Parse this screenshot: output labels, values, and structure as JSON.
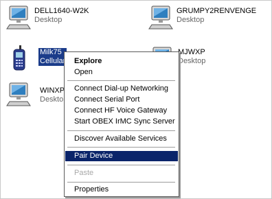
{
  "devices": [
    {
      "name": "DELL1640-W2K",
      "type": "Desktop",
      "icon": "desktop-computer-icon"
    },
    {
      "name": "GRUMPY2RENVENGE",
      "type": "Desktop",
      "icon": "desktop-computer-icon"
    },
    {
      "name": "Milk75",
      "type": "Cellular",
      "icon": "cell-phone-icon",
      "selected": true
    },
    {
      "name": "MJWXP",
      "type": "Desktop",
      "icon": "desktop-computer-icon"
    },
    {
      "name": "WINXP",
      "type": "Deskto",
      "icon": "desktop-computer-icon"
    }
  ],
  "context_menu": {
    "items": [
      {
        "label": "Explore",
        "bold": true
      },
      {
        "label": "Open"
      },
      {
        "label": "Connect Dial-up Networking"
      },
      {
        "label": "Connect Serial Port"
      },
      {
        "label": "Connect HF Voice Gateway"
      },
      {
        "label": "Start OBEX IrMC Sync Server"
      },
      {
        "label": "Discover Available Services"
      },
      {
        "label": "Pair Device",
        "highlighted": true
      },
      {
        "label": "Paste",
        "disabled": true
      },
      {
        "label": "Properties"
      }
    ]
  },
  "colors": {
    "selection": "#0a246a",
    "menu_border": "#5a5a5a",
    "disabled_text": "#a8a8a8"
  }
}
